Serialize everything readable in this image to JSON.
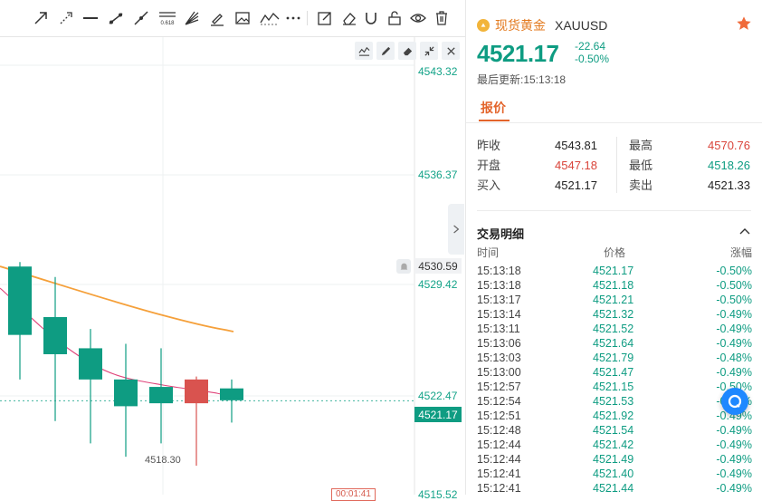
{
  "chart": {
    "price_axis": [
      "4543.32",
      "4536.37",
      "4529.42",
      "4522.47",
      "4515.52"
    ],
    "current_price_tag": "4521.17",
    "alert_price_tag": "4530.59",
    "low_label": "4518.30",
    "countdown": "00:01:41",
    "colors": {
      "up": "#0e9c82",
      "down": "#d9534f",
      "ma_orange": "#f5a03a",
      "ma_pink": "#e0457b"
    },
    "candles": [
      {
        "open": 4530.2,
        "high": 4530.5,
        "low": 4522.6,
        "close": 4525.6,
        "dir": "down_teal"
      },
      {
        "open": 4526.8,
        "high": 4529.5,
        "low": 4519.8,
        "close": 4524.3,
        "dir": "down_teal"
      },
      {
        "open": 4524.7,
        "high": 4526.0,
        "low": 4518.3,
        "close": 4522.6,
        "dir": "down_teal"
      },
      {
        "open": 4522.6,
        "high": 4525.0,
        "low": 4517.4,
        "close": 4520.8,
        "dir": "down_teal"
      },
      {
        "open": 4522.1,
        "high": 4524.7,
        "low": 4518.3,
        "close": 4521.0,
        "dir": "down_teal"
      },
      {
        "open": 4521.0,
        "high": 4522.8,
        "low": 4516.8,
        "close": 4522.6,
        "dir": "up_red"
      },
      {
        "open": 4522.0,
        "high": 4522.6,
        "low": 4519.7,
        "close": 4521.2,
        "dir": "down_teal"
      }
    ],
    "icons": [
      "arrow-icon",
      "ray-icon",
      "horizontal-line-icon",
      "trend-line-icon",
      "extended-line-icon",
      "fibonacci-icon",
      "fan-icon",
      "brush-icon",
      "image-icon",
      "pattern-icon",
      "more-icon",
      "note-icon",
      "eraser-icon",
      "magnet-icon",
      "lock-icon",
      "eye-icon",
      "trash-icon"
    ],
    "fib_text": "0.618"
  },
  "panel": {
    "instrument_cn": "现货黄金",
    "instrument_code": "XAUUSD",
    "price": "4521.17",
    "change": "-22.64",
    "change_pct": "-0.50%",
    "updated": "最后更新:15:13:18",
    "tab_quote": "报价",
    "quote": {
      "prev_close_label": "昨收",
      "prev_close": "4543.81",
      "open_label": "开盘",
      "open": "4547.18",
      "bid_label": "买入",
      "bid": "4521.17",
      "high_label": "最高",
      "high": "4570.76",
      "low_label": "最低",
      "low": "4518.26",
      "ask_label": "卖出",
      "ask": "4521.33"
    },
    "trade_title": "交易明细",
    "trade_headers": {
      "time": "时间",
      "price": "价格",
      "change": "涨幅"
    },
    "trades": [
      {
        "time": "15:13:18",
        "price": "4521.17",
        "change": "-0.50%"
      },
      {
        "time": "15:13:18",
        "price": "4521.18",
        "change": "-0.50%"
      },
      {
        "time": "15:13:17",
        "price": "4521.21",
        "change": "-0.50%"
      },
      {
        "time": "15:13:14",
        "price": "4521.32",
        "change": "-0.49%"
      },
      {
        "time": "15:13:11",
        "price": "4521.52",
        "change": "-0.49%"
      },
      {
        "time": "15:13:06",
        "price": "4521.64",
        "change": "-0.49%"
      },
      {
        "time": "15:13:03",
        "price": "4521.79",
        "change": "-0.48%"
      },
      {
        "time": "15:13:00",
        "price": "4521.47",
        "change": "-0.49%"
      },
      {
        "time": "15:12:57",
        "price": "4521.15",
        "change": "-0.50%"
      },
      {
        "time": "15:12:54",
        "price": "4521.53",
        "change": "-0.49%"
      },
      {
        "time": "15:12:51",
        "price": "4521.92",
        "change": "-0.49%"
      },
      {
        "time": "15:12:48",
        "price": "4521.54",
        "change": "-0.49%"
      },
      {
        "time": "15:12:44",
        "price": "4521.42",
        "change": "-0.49%"
      },
      {
        "time": "15:12:44",
        "price": "4521.49",
        "change": "-0.49%"
      },
      {
        "time": "15:12:41",
        "price": "4521.40",
        "change": "-0.49%"
      },
      {
        "time": "15:12:41",
        "price": "4521.44",
        "change": "-0.49%"
      }
    ]
  }
}
